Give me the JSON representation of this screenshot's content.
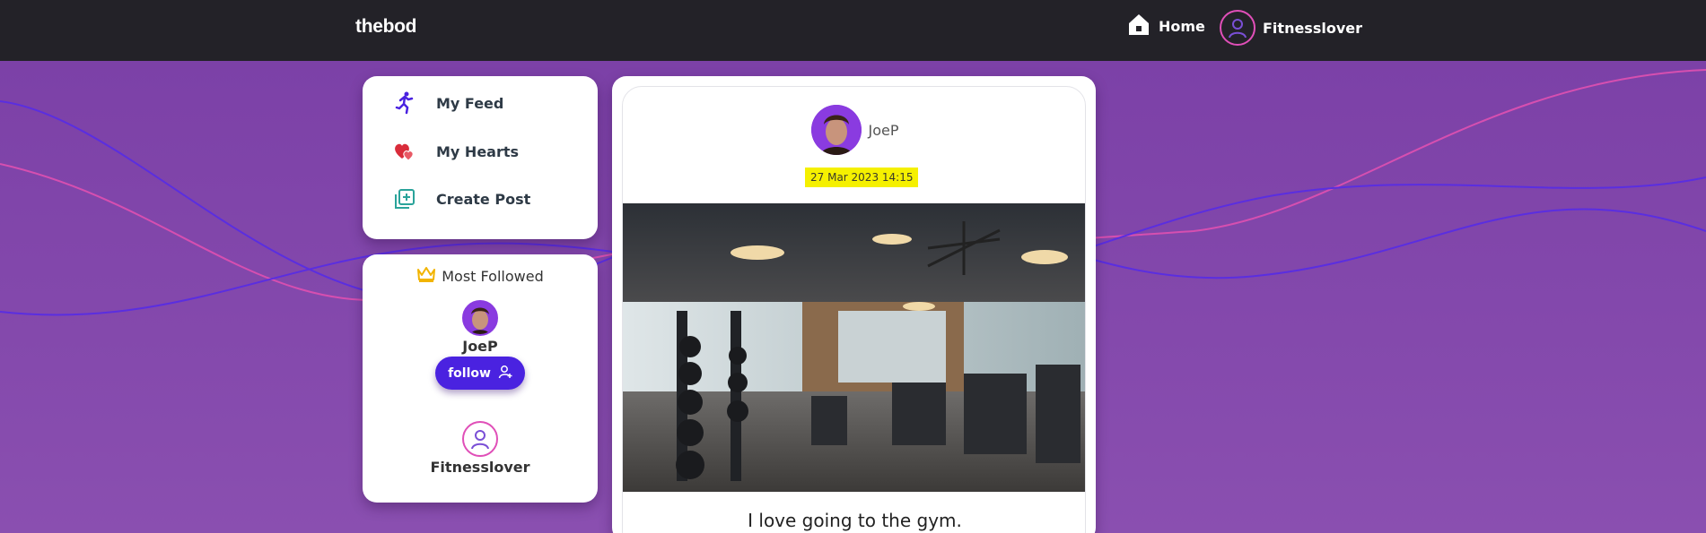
{
  "app": {
    "brand": "thebod"
  },
  "nav": {
    "home_label": "Home",
    "user_label": "Fitnesslover"
  },
  "menu": {
    "items": [
      {
        "label": "My Feed",
        "icon": "runner-icon"
      },
      {
        "label": "My Hearts",
        "icon": "hearts-icon"
      },
      {
        "label": "Create Post",
        "icon": "add-square-icon"
      }
    ]
  },
  "most_followed": {
    "title": "Most Followed",
    "users": [
      {
        "name": "JoeP",
        "button_label": "follow"
      },
      {
        "name": "Fitnesslover"
      }
    ]
  },
  "post": {
    "author": "JoeP",
    "date": "27 Mar 2023 14:15",
    "caption": "I love going to the gym."
  },
  "colors": {
    "topbar": "#232228",
    "background": "#7a3fa6",
    "accent_button": "#4a22e0",
    "avatar_ring": "#e04fb8",
    "highlight": "#f5f000"
  }
}
